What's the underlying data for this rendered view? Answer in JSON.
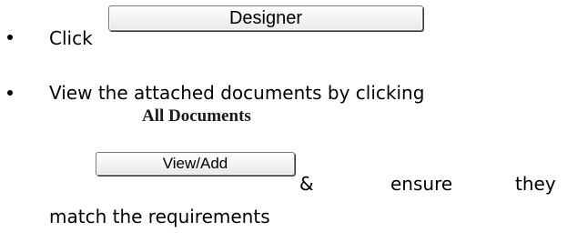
{
  "step1": {
    "click_text": "Click",
    "designer_button": "Designer"
  },
  "step2": {
    "line1": "View the attached documents by clicking",
    "section_heading": "All Documents",
    "view_add_button": "View/Add",
    "amp": "&",
    "ensure": "ensure",
    "they": "they",
    "line3": "match the requirements"
  }
}
